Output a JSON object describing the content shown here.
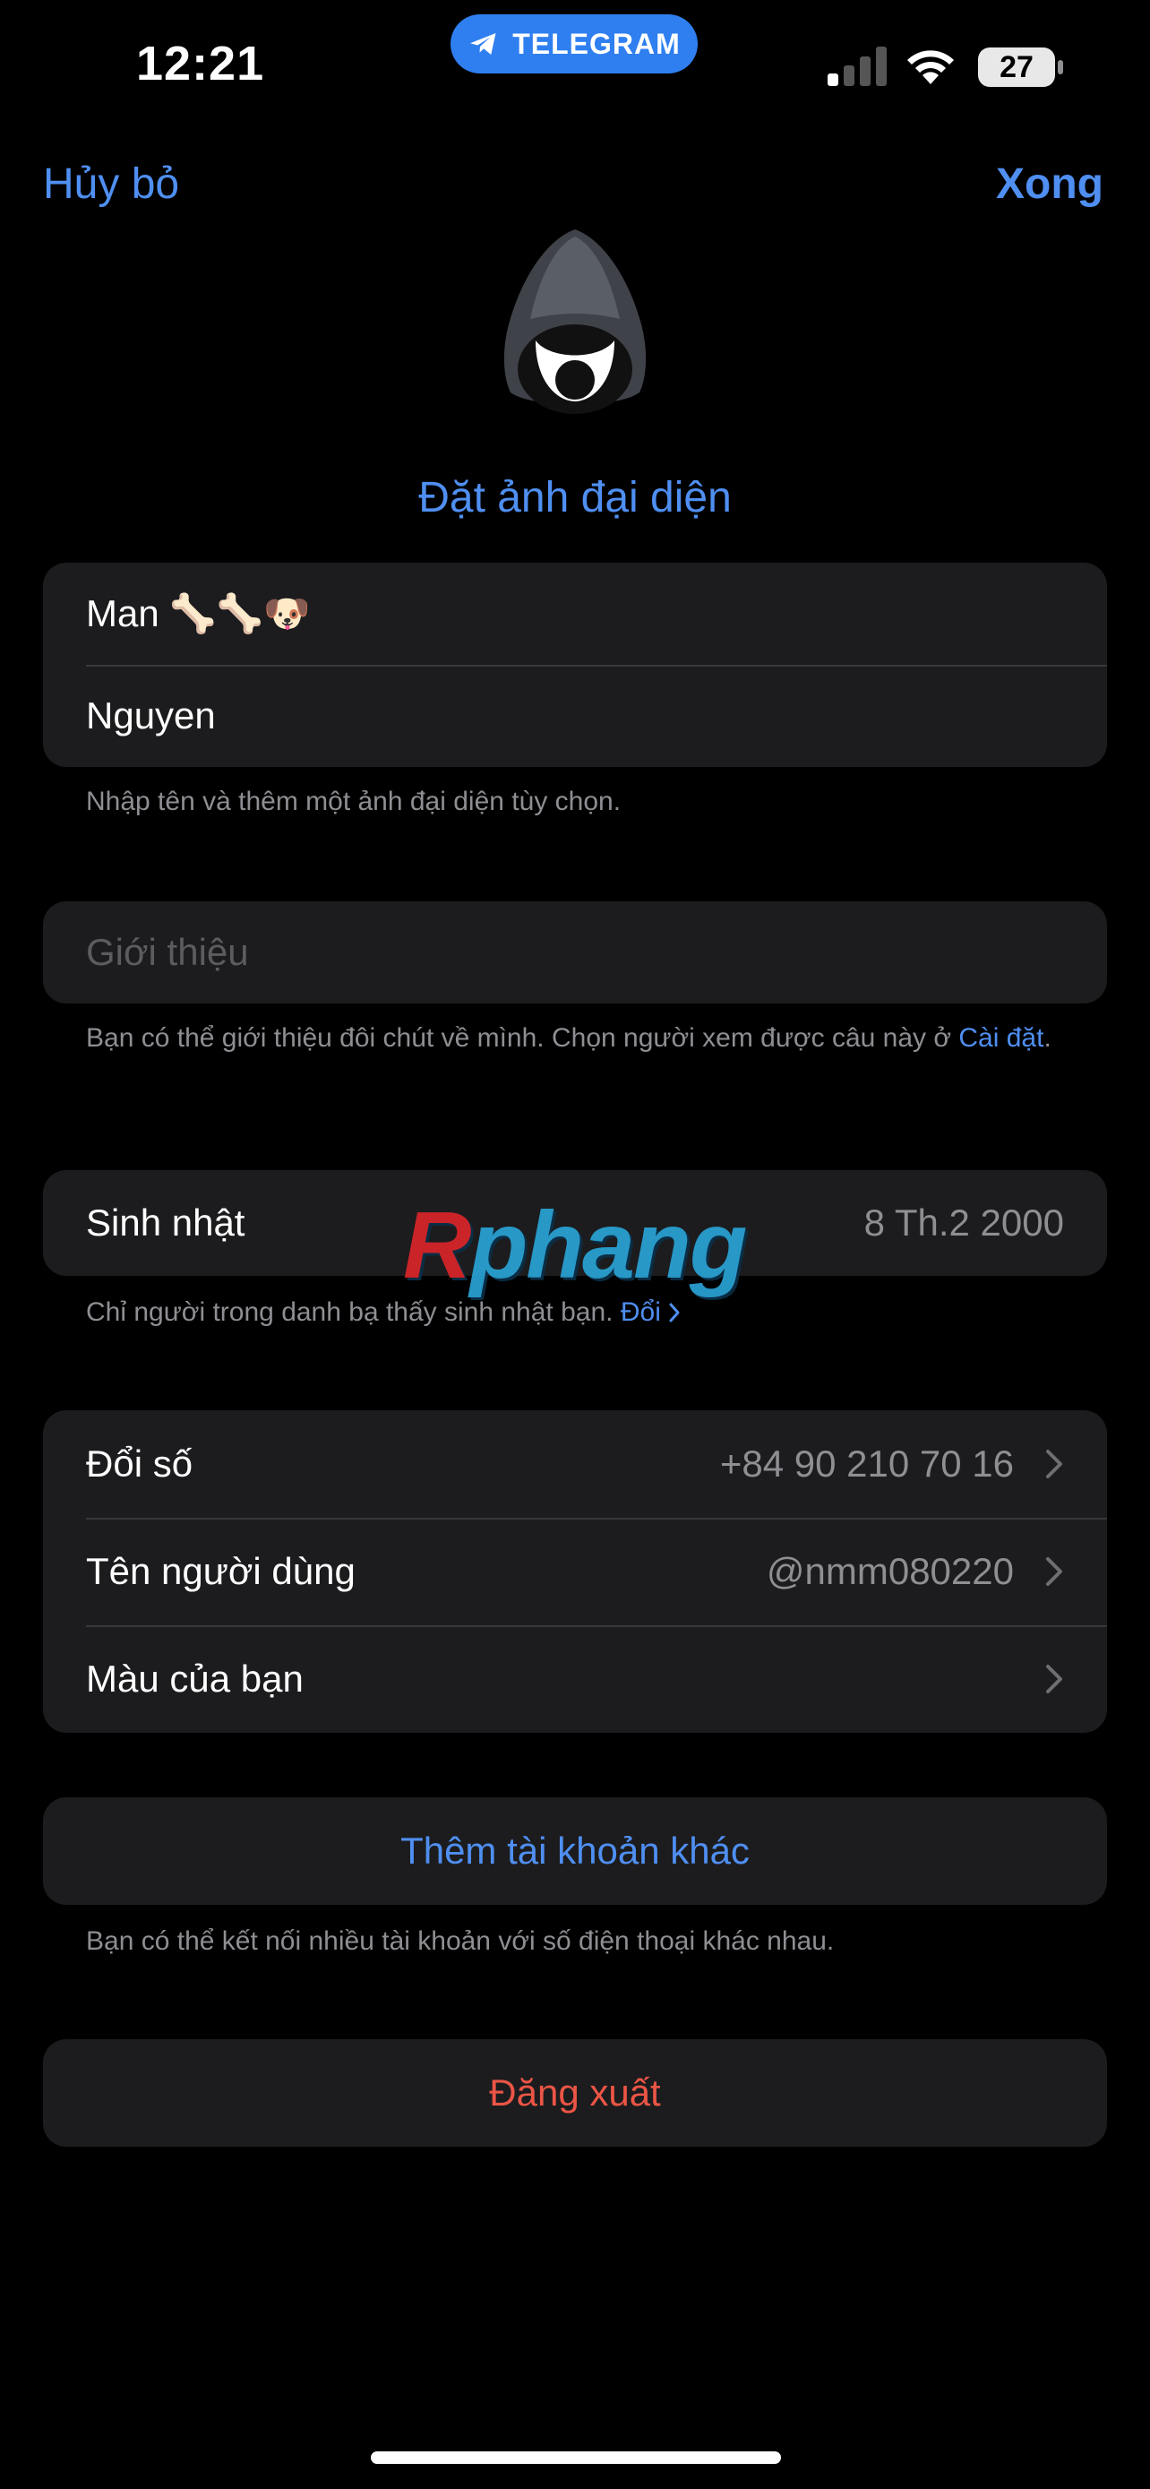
{
  "status_bar": {
    "time": "12:21",
    "app_pill": "TELEGRAM",
    "battery": "27"
  },
  "nav": {
    "cancel": "Hủy bỏ",
    "done": "Xong"
  },
  "profile": {
    "set_photo": "Đặt ảnh đại diện",
    "first_name": "Man 🦴🦴🐶",
    "last_name": "Nguyen",
    "name_footnote": "Nhập tên và thêm một ảnh đại diện tùy chọn.",
    "bio_placeholder": "Giới thiệu",
    "bio_footnote": "Bạn có thể giới thiệu đôi chút về mình. Chọn người xem được câu này ở",
    "bio_footnote_link": "Cài đặt",
    "bio_footnote_end": "."
  },
  "birthday": {
    "label": "Sinh nhật",
    "value": "8 Th.2 2000",
    "footnote": "Chỉ người trong danh bạ thấy sinh nhật bạn.",
    "footnote_link": "Đổi"
  },
  "account": {
    "items": [
      {
        "label": "Đổi số",
        "value": "+84 90 210 70 16"
      },
      {
        "label": "Tên người dùng",
        "value": "@nmm080220"
      },
      {
        "label": "Màu của bạn",
        "value": ""
      }
    ]
  },
  "add_account": {
    "label": "Thêm tài khoản khác",
    "footnote": "Bạn có thể kết nối nhiều tài khoản với số điện thoại khác nhau."
  },
  "logout": {
    "label": "Đăng xuất"
  },
  "watermark": {
    "first": "R",
    "rest": "phang"
  },
  "colors": {
    "accent": "#4f8ff1",
    "destructive": "#eb5545",
    "background": "#000000",
    "cell": "#1c1c1e"
  }
}
